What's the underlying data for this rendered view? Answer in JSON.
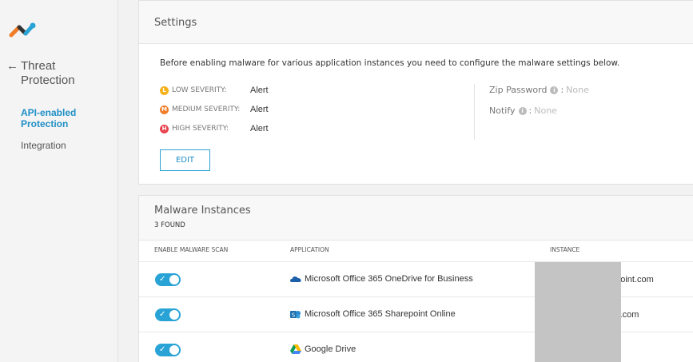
{
  "sidebar": {
    "back_title": "Threat Protection",
    "nav_items": [
      {
        "label": "API-enabled Protection",
        "active": true
      },
      {
        "label": "Integration",
        "active": false
      }
    ]
  },
  "settings": {
    "title": "Settings",
    "description": "Before enabling malware for various application instances you need to configure the malware settings below.",
    "severities": [
      {
        "letter": "L",
        "label": "LOW SEVERITY:",
        "value": "Alert",
        "color": "#f5b21b"
      },
      {
        "letter": "M",
        "label": "MEDIUM SEVERITY:",
        "value": "Alert",
        "color": "#f07d28"
      },
      {
        "letter": "H",
        "label": "HIGH SEVERITY:",
        "value": "Alert",
        "color": "#e8434e"
      }
    ],
    "zip_password": {
      "label": "Zip Password",
      "value": "None"
    },
    "notify": {
      "label": "Notify",
      "value": "None"
    },
    "edit_label": "EDIT"
  },
  "instances": {
    "title": "Malware Instances",
    "count": "3 FOUND",
    "columns": {
      "scan": "ENABLE MALWARE SCAN",
      "app": "APPLICATION",
      "instance": "INSTANCE"
    },
    "rows": [
      {
        "app": "Microsoft Office 365 OneDrive for Business",
        "icon": "onedrive-icon",
        "instance": "epoint.com",
        "enabled": true
      },
      {
        "app": "Microsoft Office 365 Sharepoint Online",
        "icon": "sharepoint-icon",
        "instance": "int.com",
        "enabled": true
      },
      {
        "app": "Google Drive",
        "icon": "google-drive-icon",
        "instance": "",
        "enabled": true
      }
    ]
  },
  "colors": {
    "accent": "#29a3d6",
    "active_nav": "#1f8fc6"
  }
}
